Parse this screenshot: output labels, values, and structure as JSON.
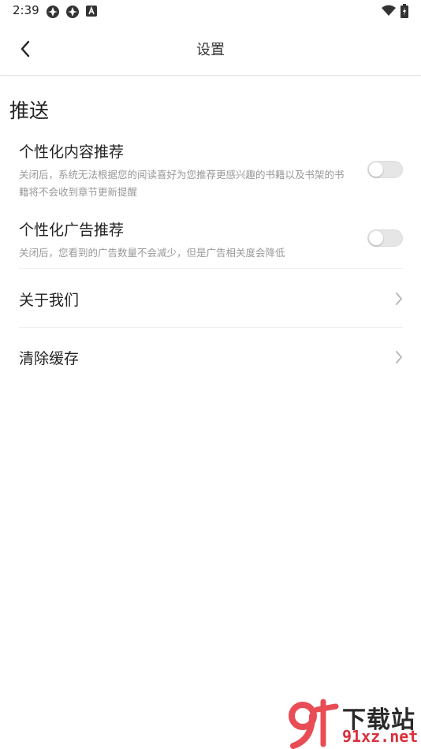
{
  "status_bar": {
    "time": "2:39",
    "icons_left": [
      "app-notification-icon",
      "app-notification-icon",
      "a-box-icon"
    ],
    "icons_right": [
      "wifi-icon",
      "battery-icon"
    ]
  },
  "app_bar": {
    "title": "设置",
    "back_icon": "chevron-left-icon"
  },
  "section": {
    "title": "推送"
  },
  "settings": [
    {
      "title": "个性化内容推荐",
      "desc": "关闭后，系统无法根据您的阅读喜好为您推荐更感兴趣的书籍以及书架的书籍将不会收到章节更新提醒",
      "enabled": false
    },
    {
      "title": "个性化广告推荐",
      "desc": "关闭后，您看到的广告数量不会减少，但是广告相关度会降低",
      "enabled": false
    }
  ],
  "nav_items": [
    {
      "label": "关于我们",
      "icon": "chevron-right-icon"
    },
    {
      "label": "清除缓存",
      "icon": "chevron-right-icon"
    }
  ],
  "watermark": {
    "logo_mark": "9f",
    "line1": "下载站",
    "line2": "91xz.net"
  },
  "colors": {
    "background": "#ffffff",
    "text_primary": "#222222",
    "text_secondary": "#999999",
    "toggle_off": "#e6e6e6",
    "watermark_red": "#d9303b"
  }
}
